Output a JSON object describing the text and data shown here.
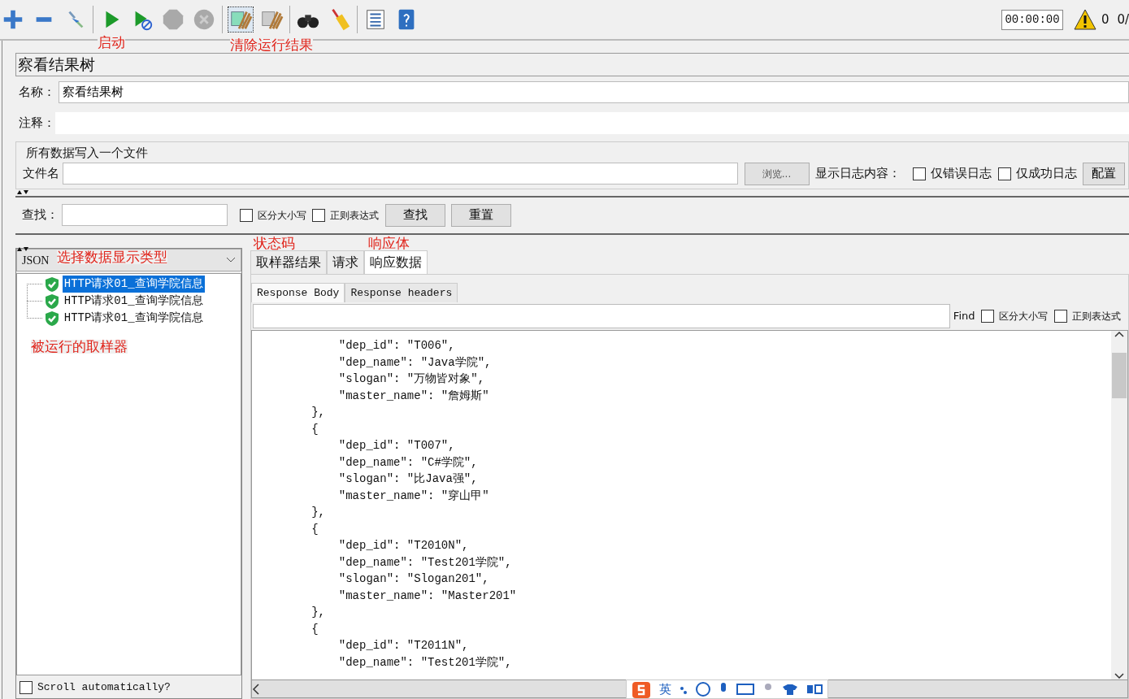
{
  "toolbar": {
    "timer": "00:00:00",
    "warning_count": "0",
    "thread_count": "0/"
  },
  "annotations": [
    {
      "text": "启动"
    },
    {
      "text": "清除运行结果"
    },
    {
      "text": "状态码"
    },
    {
      "text": "响应体"
    },
    {
      "text": "选择数据显示类型"
    },
    {
      "text": "被运行的取样器"
    }
  ],
  "panel": {
    "title": "察看结果树",
    "name_label": "名称：",
    "name_value": "察看结果树",
    "comment_label": "注释：",
    "file_group": {
      "legend": "所有数据写入一个文件",
      "file_label": "文件名",
      "browse_button": "浏览...",
      "log_label": "显示日志内容：",
      "options": [
        {
          "label": "仅错误日志",
          "checked": false
        },
        {
          "label": "仅成功日志",
          "checked": false
        }
      ],
      "config_button": "配置"
    },
    "search": {
      "label": "查找：",
      "options": [
        {
          "label": "区分大小写",
          "checked": false
        },
        {
          "label": "正则表达式",
          "checked": false
        }
      ],
      "buttons": [
        "查找",
        "重置"
      ]
    },
    "renderer": "JSON",
    "samples": [
      {
        "label": "HTTP请求01_查询学院信息",
        "selected": true
      },
      {
        "label": "HTTP请求01_查询学院信息",
        "selected": false
      },
      {
        "label": "HTTP请求01_查询学院信息",
        "selected": false
      }
    ],
    "scroll_auto": {
      "label": "Scroll automatically?",
      "checked": false
    },
    "tabs": [
      {
        "label": "取样器结果",
        "selected": false
      },
      {
        "label": "请求",
        "selected": false
      },
      {
        "label": "响应数据",
        "selected": true
      }
    ],
    "subtabs": [
      {
        "label": "Response Body",
        "selected": true
      },
      {
        "label": "Response headers",
        "selected": false
      }
    ],
    "find": {
      "label": "Find",
      "options": [
        {
          "label": "区分大小写",
          "checked": false
        },
        {
          "label": "正则表达式",
          "checked": false
        }
      ]
    },
    "body_lines": [
      "            \"dep_id\": \"T006\",",
      "            \"dep_name\": \"Java学院\",",
      "            \"slogan\": \"万物皆对象\",",
      "            \"master_name\": \"詹姆斯\"",
      "        },",
      "        {",
      "            \"dep_id\": \"T007\",",
      "            \"dep_name\": \"C#学院\",",
      "            \"slogan\": \"比Java强\",",
      "            \"master_name\": \"穿山甲\"",
      "        },",
      "        {",
      "            \"dep_id\": \"T2010N\",",
      "            \"dep_name\": \"Test201学院\",",
      "            \"slogan\": \"Slogan201\",",
      "            \"master_name\": \"Master201\"",
      "        },",
      "        {",
      "            \"dep_id\": \"T2011N\",",
      "            \"dep_name\": \"Test201学院\","
    ]
  },
  "ime_bar": {
    "label": "英"
  }
}
